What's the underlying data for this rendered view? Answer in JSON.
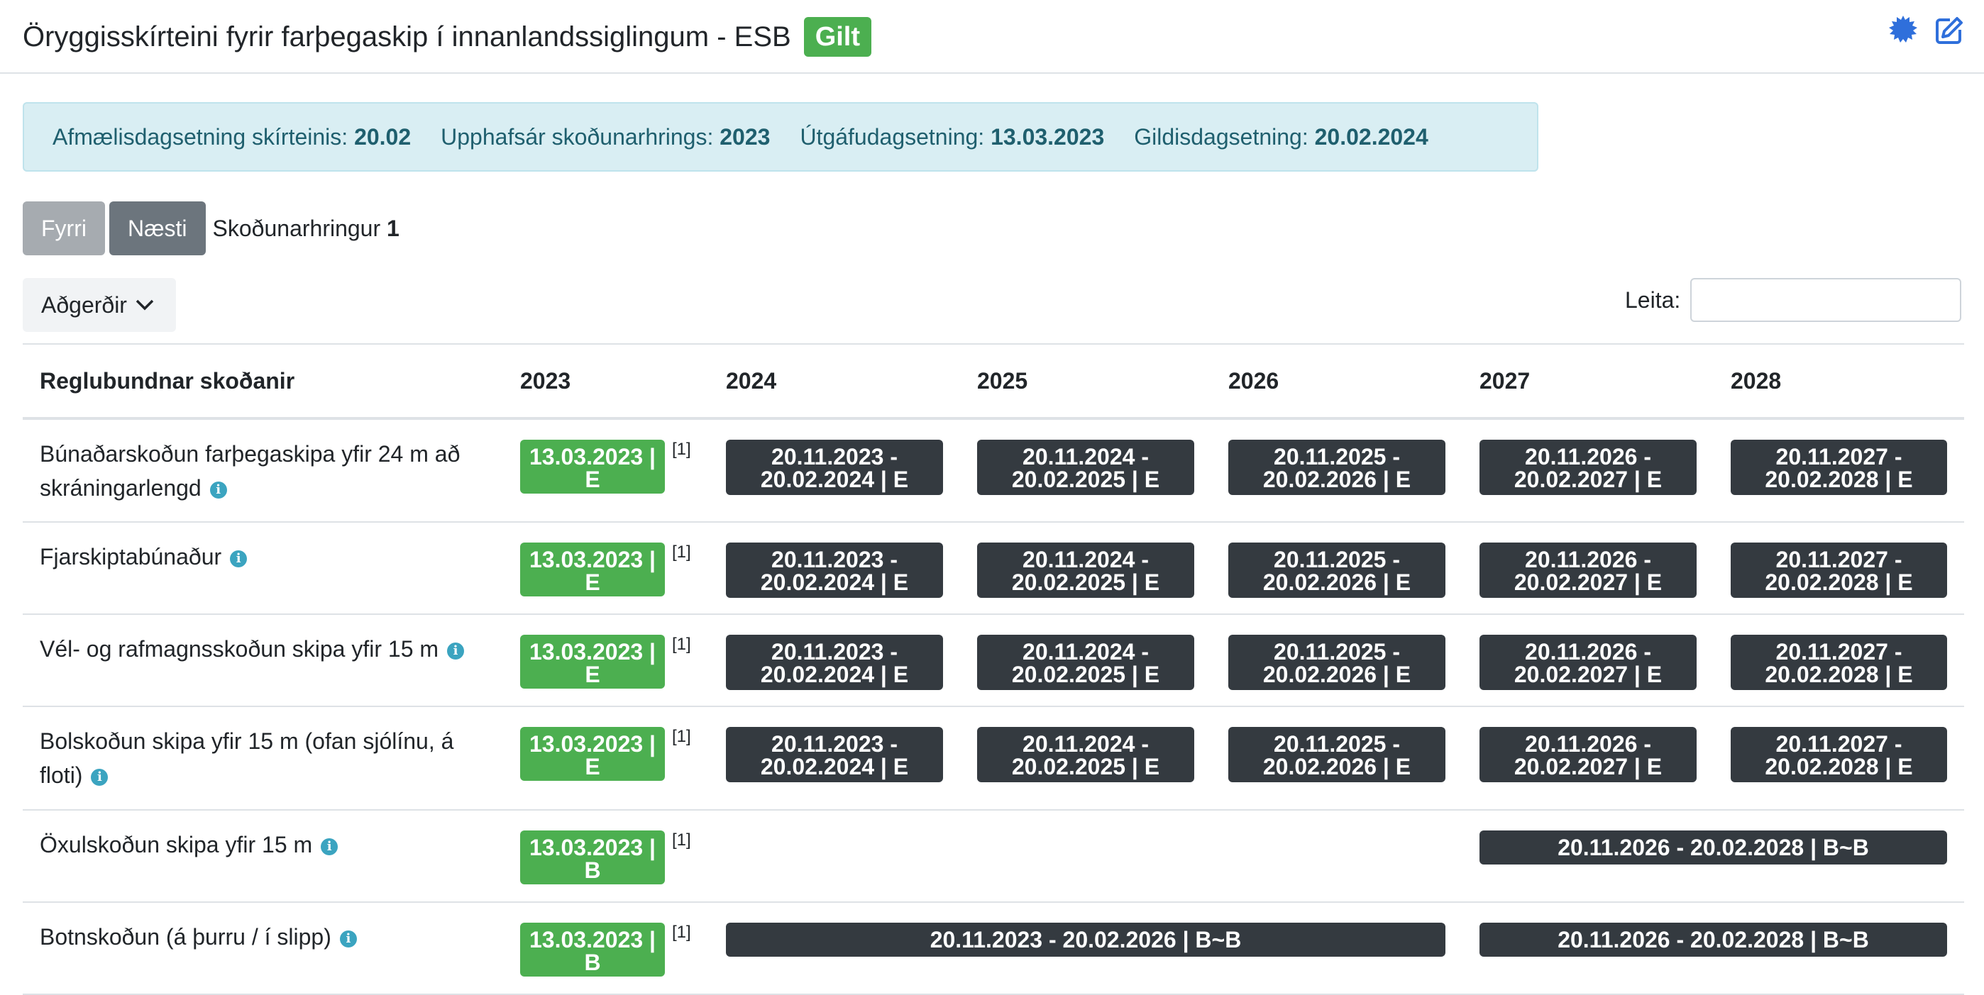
{
  "header": {
    "title": "Öryggisskírteini fyrir farþegaskip í innanlandssiglingum - ESB",
    "status": "Gilt"
  },
  "info": {
    "anniversary_label": "Afmælisdagsetning skírteinis:",
    "anniversary_value": "20.02",
    "cycle_start_label": "Upphafsár skoðunarhrings:",
    "cycle_start_value": "2023",
    "issue_label": "Útgáfudagsetning:",
    "issue_value": "13.03.2023",
    "valid_label": "Gildisdagsetning:",
    "valid_value": "20.02.2024"
  },
  "pager": {
    "prev_label": "Fyrri",
    "next_label": "Næsti",
    "cycle_label": "Skoðunarhringur",
    "cycle_value": "1"
  },
  "toolbar": {
    "actions_label": "Aðgerðir",
    "search_label": "Leita:"
  },
  "table": {
    "columns": [
      "Reglubundnar skoðanir",
      "2023",
      "2024",
      "2025",
      "2026",
      "2027",
      "2028"
    ],
    "rows": [
      {
        "name": "Búnaðarskoðun farþegaskipa yfir 24 m að skráningarlengd",
        "done": "13.03.2023 | E",
        "ref": "[1]",
        "periods": [
          "20.11.2023 - 20.02.2024 | E",
          "20.11.2024 - 20.02.2025 | E",
          "20.11.2025 - 20.02.2026 | E",
          "20.11.2026 - 20.02.2027 | E",
          "20.11.2027 - 20.02.2028 | E"
        ]
      },
      {
        "name": "Fjarskiptabúnaður",
        "done": "13.03.2023 | E",
        "ref": "[1]",
        "periods": [
          "20.11.2023 - 20.02.2024 | E",
          "20.11.2024 - 20.02.2025 | E",
          "20.11.2025 - 20.02.2026 | E",
          "20.11.2026 - 20.02.2027 | E",
          "20.11.2027 - 20.02.2028 | E"
        ]
      },
      {
        "name": "Vél- og rafmagnsskoðun skipa yfir 15 m",
        "done": "13.03.2023 | E",
        "ref": "[1]",
        "periods": [
          "20.11.2023 - 20.02.2024 | E",
          "20.11.2024 - 20.02.2025 | E",
          "20.11.2025 - 20.02.2026 | E",
          "20.11.2026 - 20.02.2027 | E",
          "20.11.2027 - 20.02.2028 | E"
        ]
      },
      {
        "name": "Bolskoðun skipa yfir 15 m (ofan sjólínu, á floti)",
        "done": "13.03.2023 | E",
        "ref": "[1]",
        "periods": [
          "20.11.2023 - 20.02.2024 | E",
          "20.11.2024 - 20.02.2025 | E",
          "20.11.2025 - 20.02.2026 | E",
          "20.11.2026 - 20.02.2027 | E",
          "20.11.2027 - 20.02.2028 | E"
        ]
      },
      {
        "name": "Öxulskoðun skipa yfir 15 m",
        "done": "13.03.2023 | B",
        "ref": "[1]",
        "span_2027_2028": "20.11.2026 - 20.02.2028 | B~B"
      },
      {
        "name": "Botnskoðun (á þurru / í slipp)",
        "done": "13.03.2023 | B",
        "ref": "[1]",
        "span_2024_2026": "20.11.2023 - 20.02.2026 | B~B",
        "span_2027_2028": "20.11.2026 - 20.02.2028 | B~B"
      }
    ]
  },
  "colors": {
    "success": "#4caf50",
    "dark": "#343a40",
    "info_bg": "#d9eef3",
    "accent": "#2f6fdb"
  },
  "icons": [
    "settings-icon",
    "edit-icon",
    "chevron-down-icon",
    "info-icon"
  ]
}
